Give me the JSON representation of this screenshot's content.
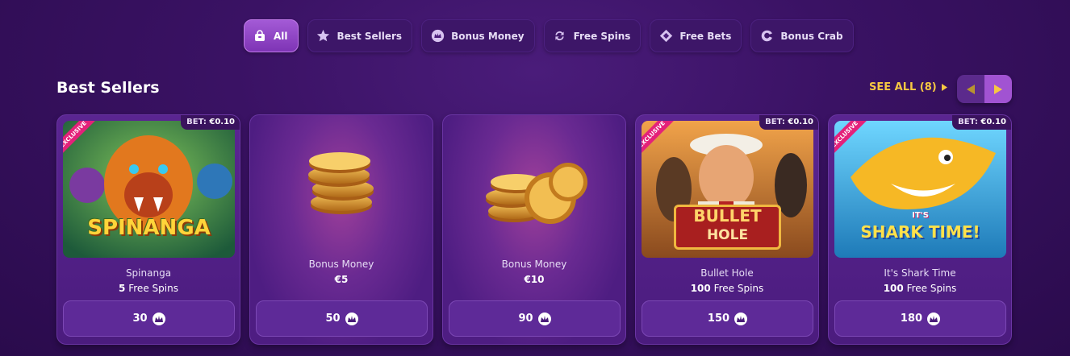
{
  "filters": [
    {
      "label": "All",
      "icon": "bag-icon",
      "active": true
    },
    {
      "label": "Best Sellers",
      "icon": "star-icon"
    },
    {
      "label": "Bonus Money",
      "icon": "crown-icon"
    },
    {
      "label": "Free Spins",
      "icon": "refresh-icon"
    },
    {
      "label": "Free Bets",
      "icon": "ticket-icon"
    },
    {
      "label": "Bonus Crab",
      "icon": "crab-icon"
    }
  ],
  "section": {
    "title": "Best Sellers",
    "see_all": "SEE ALL (8)"
  },
  "cards": [
    {
      "title": "Spinanga",
      "sub_value": "5",
      "sub_text": "Free Spins",
      "price": "30",
      "bet_label": "BET:",
      "bet_value": "€0.10",
      "badge": "EXCLUSIVE",
      "logo_text": "SPINANGA"
    },
    {
      "title": "Bonus Money",
      "sub_value": "€5",
      "sub_text": "",
      "price": "50"
    },
    {
      "title": "Bonus Money",
      "sub_value": "€10",
      "sub_text": "",
      "price": "90"
    },
    {
      "title": "Bullet Hole",
      "sub_value": "100",
      "sub_text": "Free Spins",
      "price": "150",
      "bet_label": "BET:",
      "bet_value": "€0.10",
      "badge": "EXCLUSIVE",
      "logo_text_1": "BULLET",
      "logo_text_2": "HOLE"
    },
    {
      "title": "It's Shark Time",
      "sub_value": "100",
      "sub_text": "Free Spins",
      "price": "180",
      "bet_label": "BET:",
      "bet_value": "€0.10",
      "badge": "EXCLUSIVE",
      "logo_text_1": "IT'S",
      "logo_text_2": "SHARK TIME!"
    }
  ],
  "colors": {
    "accent": "#f7c842",
    "active_chip": "#a35ad6",
    "exclusive": "#e4217a"
  }
}
